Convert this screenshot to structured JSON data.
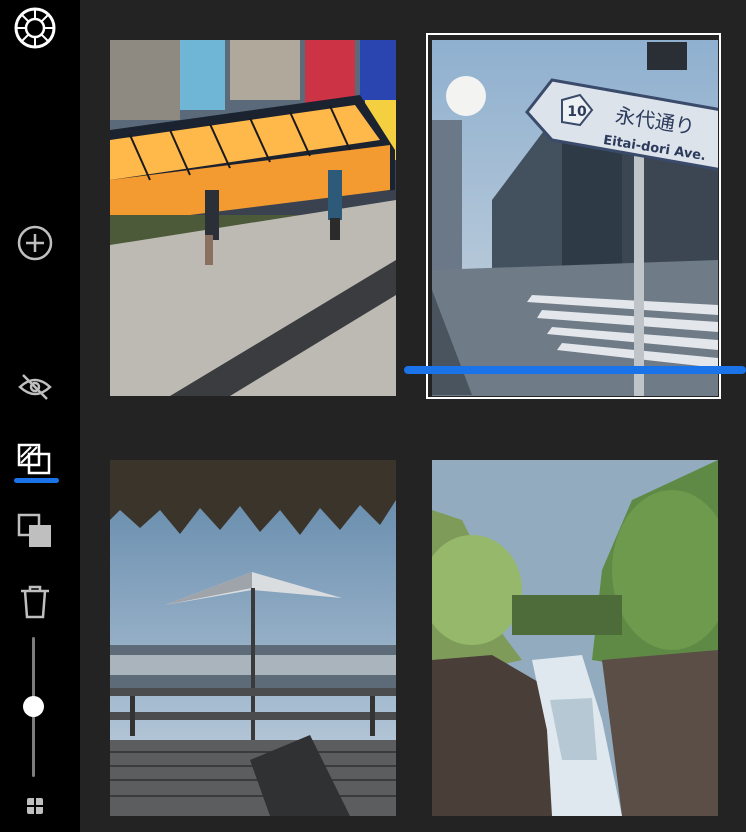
{
  "sidebar": {
    "tools": [
      {
        "icon": "logo-icon"
      },
      {
        "icon": "add-icon"
      },
      {
        "icon": "hide-icon"
      },
      {
        "icon": "compare-icon",
        "active": true
      },
      {
        "icon": "duplicate-icon"
      },
      {
        "icon": "trash-icon"
      }
    ],
    "size_slider": {
      "value": 0.57
    },
    "grid_icon": "grid-icon",
    "accent_color": "#1a73e8"
  },
  "grid": {
    "photos": [
      {
        "subject": "night-terrace-cafe"
      },
      {
        "subject": "street-sign",
        "selected": true,
        "sign_number": "10",
        "sign_jp": "永代通り",
        "sign_en": "Eitai-dori Ave."
      },
      {
        "subject": "beach-umbrella"
      },
      {
        "subject": "river-gorge"
      }
    ]
  }
}
